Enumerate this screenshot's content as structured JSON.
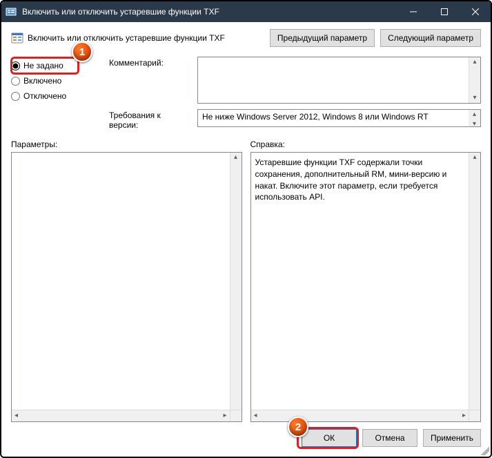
{
  "window": {
    "title": "Включить или отключить устаревшие функции TXF"
  },
  "header": {
    "title": "Включить или отключить устаревшие функции TXF",
    "prev": "Предыдущий параметр",
    "next": "Следующий параметр"
  },
  "state": {
    "not_configured": "Не задано",
    "enabled": "Включено",
    "disabled": "Отключено"
  },
  "fields": {
    "comment_label": "Комментарий:",
    "comment_value": "",
    "supported_label": "Требования к версии:",
    "supported_value": "Не ниже Windows Server 2012, Windows 8 или Windows RT"
  },
  "panes": {
    "options_label": "Параметры:",
    "help_label": "Справка:",
    "help_text": "Устаревшие функции TXF содержали точки сохранения, дополнительный RM, мини-версию и накат. Включите этот параметр, если требуется использовать API."
  },
  "footer": {
    "ok": "ОК",
    "cancel": "Отмена",
    "apply": "Применить"
  },
  "callouts": {
    "one": "1",
    "two": "2"
  }
}
